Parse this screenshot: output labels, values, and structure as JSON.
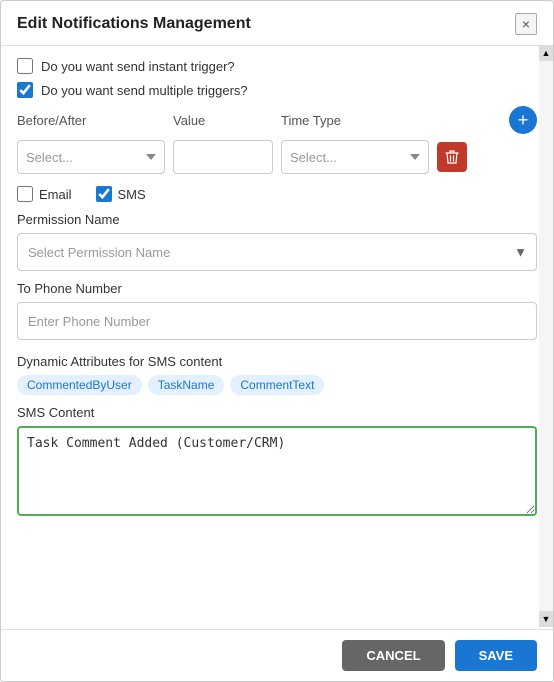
{
  "modal": {
    "title": "Edit Notifications Management",
    "close_icon": "×"
  },
  "header_checkboxes": {
    "instant_trigger_label": "Do you want send instant trigger?",
    "instant_trigger_checked": false,
    "multiple_triggers_label": "Do you want send multiple triggers?",
    "multiple_triggers_checked": true
  },
  "trigger_row": {
    "before_after_label": "Before/After",
    "value_label": "Value",
    "time_type_label": "Time Type",
    "before_after_placeholder": "Select...",
    "value_placeholder": "",
    "time_type_placeholder": "Select...",
    "add_icon": "+",
    "delete_icon": "🗑"
  },
  "channel": {
    "email_label": "Email",
    "email_checked": false,
    "sms_label": "SMS",
    "sms_checked": true
  },
  "permission": {
    "label": "Permission Name",
    "placeholder": "Select Permission Name"
  },
  "phone": {
    "label": "To Phone Number",
    "placeholder": "Enter Phone Number"
  },
  "dynamic_attrs": {
    "label": "Dynamic Attributes for SMS content",
    "tags": [
      "CommentedByUser",
      "TaskName",
      "CommentText"
    ]
  },
  "sms_content": {
    "label": "SMS Content",
    "value": "Task Comment Added (Customer/CRM)"
  },
  "footer": {
    "cancel_label": "CANCEL",
    "save_label": "SAVE"
  },
  "scroll": {
    "up_arrow": "▲",
    "down_arrow": "▼"
  }
}
